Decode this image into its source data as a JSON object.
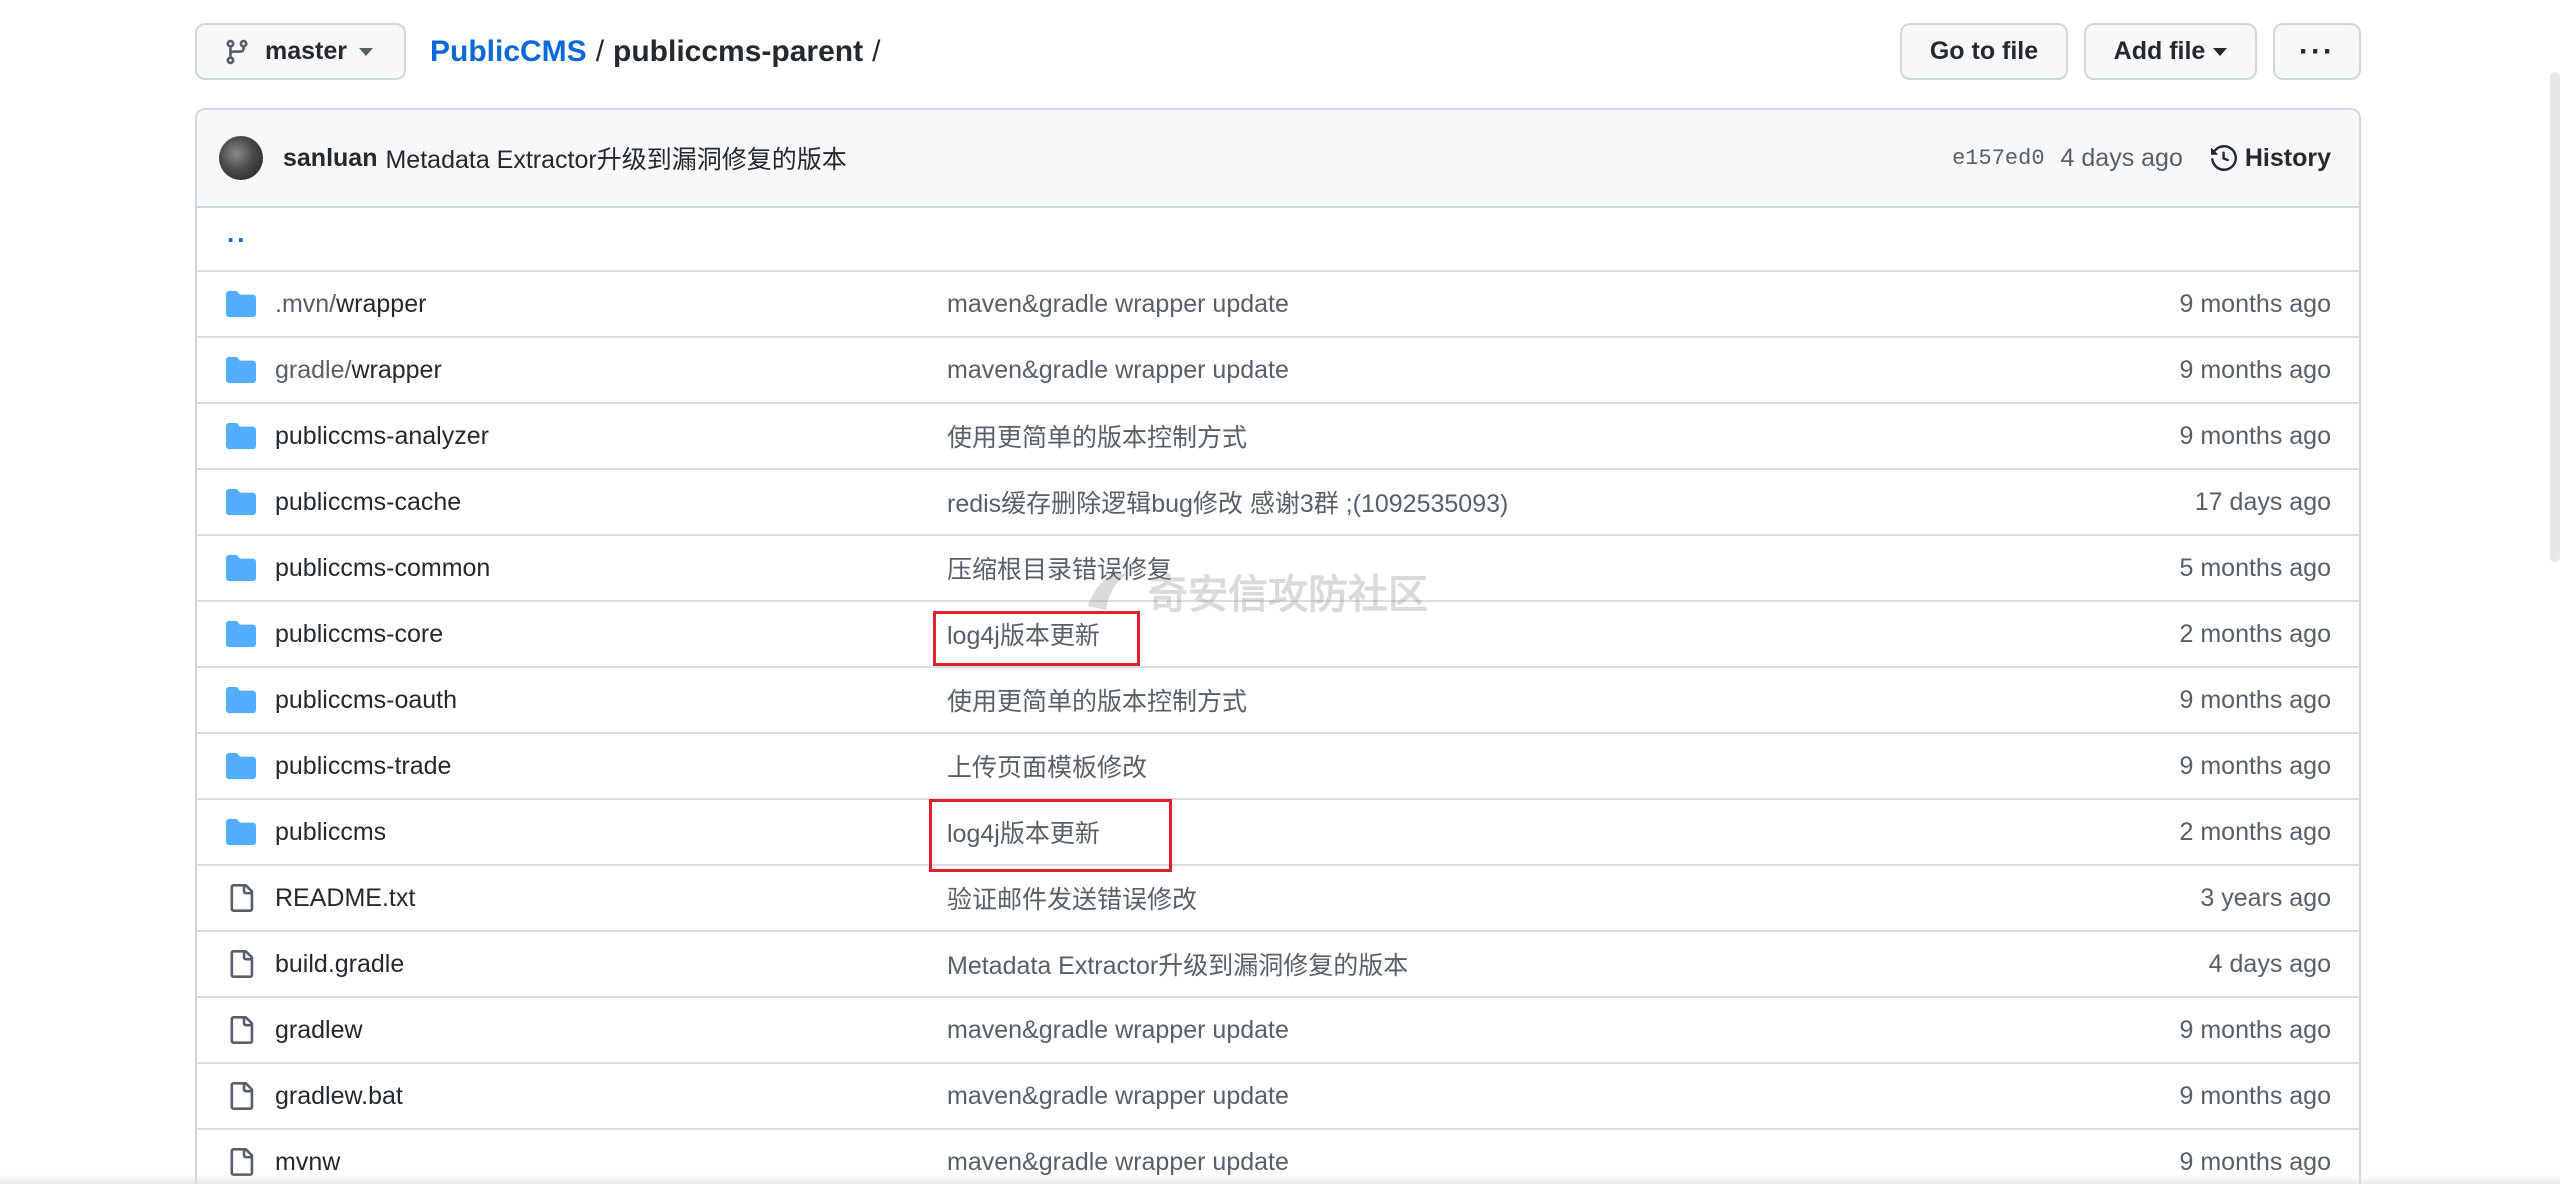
{
  "toolbar": {
    "branch_label": "master",
    "repo_owner": "PublicCMS",
    "path_sep": "/",
    "current_dir": "publiccms-parent",
    "trailing_sep": "/",
    "goto_file_label": "Go to file",
    "add_file_label": "Add file",
    "more_label": "···"
  },
  "latest_commit": {
    "author": "sanluan",
    "message": "Metadata Extractor升级到漏洞修复的版本",
    "sha": "e157ed0",
    "age": "4 days ago",
    "history_label": "History"
  },
  "parent_dir_label": "..",
  "files": [
    {
      "type": "folder",
      "name_dim": ".mvn/",
      "name": "wrapper",
      "message": "maven&gradle wrapper update",
      "age": "9 months ago"
    },
    {
      "type": "folder",
      "name_dim": "gradle/",
      "name": "wrapper",
      "message": "maven&gradle wrapper update",
      "age": "9 months ago"
    },
    {
      "type": "folder",
      "name_dim": "",
      "name": "publiccms-analyzer",
      "message": "使用更简单的版本控制方式",
      "age": "9 months ago"
    },
    {
      "type": "folder",
      "name_dim": "",
      "name": "publiccms-cache",
      "message": "redis缓存删除逻辑bug修改 感谢3群 ;(1092535093)",
      "age": "17 days ago"
    },
    {
      "type": "folder",
      "name_dim": "",
      "name": "publiccms-common",
      "message": "压缩根目录错误修复",
      "age": "5 months ago"
    },
    {
      "type": "folder",
      "name_dim": "",
      "name": "publiccms-core",
      "message": "log4j版本更新",
      "age": "2 months ago"
    },
    {
      "type": "folder",
      "name_dim": "",
      "name": "publiccms-oauth",
      "message": "使用更简单的版本控制方式",
      "age": "9 months ago"
    },
    {
      "type": "folder",
      "name_dim": "",
      "name": "publiccms-trade",
      "message": "上传页面模板修改",
      "age": "9 months ago"
    },
    {
      "type": "folder",
      "name_dim": "",
      "name": "publiccms",
      "message": "log4j版本更新",
      "age": "2 months ago"
    },
    {
      "type": "file",
      "name_dim": "",
      "name": "README.txt",
      "message": "验证邮件发送错误修改",
      "age": "3 years ago"
    },
    {
      "type": "file",
      "name_dim": "",
      "name": "build.gradle",
      "message": "Metadata Extractor升级到漏洞修复的版本",
      "age": "4 days ago"
    },
    {
      "type": "file",
      "name_dim": "",
      "name": "gradlew",
      "message": "maven&gradle wrapper update",
      "age": "9 months ago"
    },
    {
      "type": "file",
      "name_dim": "",
      "name": "gradlew.bat",
      "message": "maven&gradle wrapper update",
      "age": "9 months ago"
    },
    {
      "type": "file",
      "name_dim": "",
      "name": "mvnw",
      "message": "maven&gradle wrapper update",
      "age": "9 months ago"
    }
  ],
  "watermark": "奇安信攻防社区",
  "colors": {
    "link": "#0969da",
    "folder_icon": "#54aeff",
    "highlight_box": "#e0202a"
  }
}
